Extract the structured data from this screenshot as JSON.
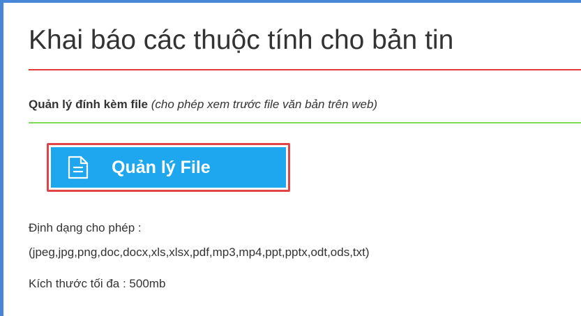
{
  "page": {
    "title": "Khai báo các thuộc tính cho bản tin"
  },
  "attachment": {
    "heading": "Quản lý đính kèm file",
    "note": "(cho phép xem trước file văn bản trên web)",
    "button_label": "Quản lý File",
    "button_icon": "file-icon"
  },
  "info": {
    "allowed_label": "Định dạng cho phép :",
    "allowed_formats": "(jpeg,jpg,png,doc,docx,xls,xlsx,pdf,mp3,mp4,ppt,pptx,odt,ods,txt)",
    "max_size": "Kích thước tối đa : 500mb"
  },
  "colors": {
    "frame": "#4a86d8",
    "title_divider": "#e03a3a",
    "section_divider": "#7ed957",
    "button": "#1ea7ee",
    "highlight": "#e04444"
  }
}
